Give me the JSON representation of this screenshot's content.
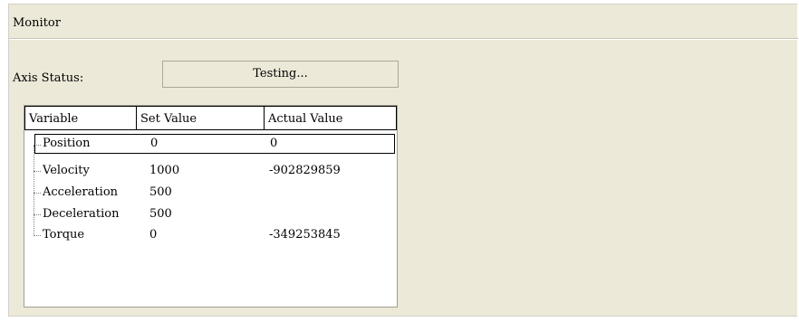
{
  "monitor": {
    "title": "Monitor",
    "axis_status_label": "Axis Status:",
    "axis_status_value": "Testing..."
  },
  "table": {
    "columns": [
      "Variable",
      "Set Value",
      "Actual Value"
    ],
    "rows": [
      {
        "variable": "Position",
        "set_value": "0",
        "actual_value": "0"
      },
      {
        "variable": "Velocity",
        "set_value": "1000",
        "actual_value": "-902829859"
      },
      {
        "variable": "Acceleration",
        "set_value": "500",
        "actual_value": ""
      },
      {
        "variable": "Deceleration",
        "set_value": "500",
        "actual_value": ""
      },
      {
        "variable": "Torque",
        "set_value": "0",
        "actual_value": "-349253845"
      }
    ],
    "selected_row": "Position"
  }
}
